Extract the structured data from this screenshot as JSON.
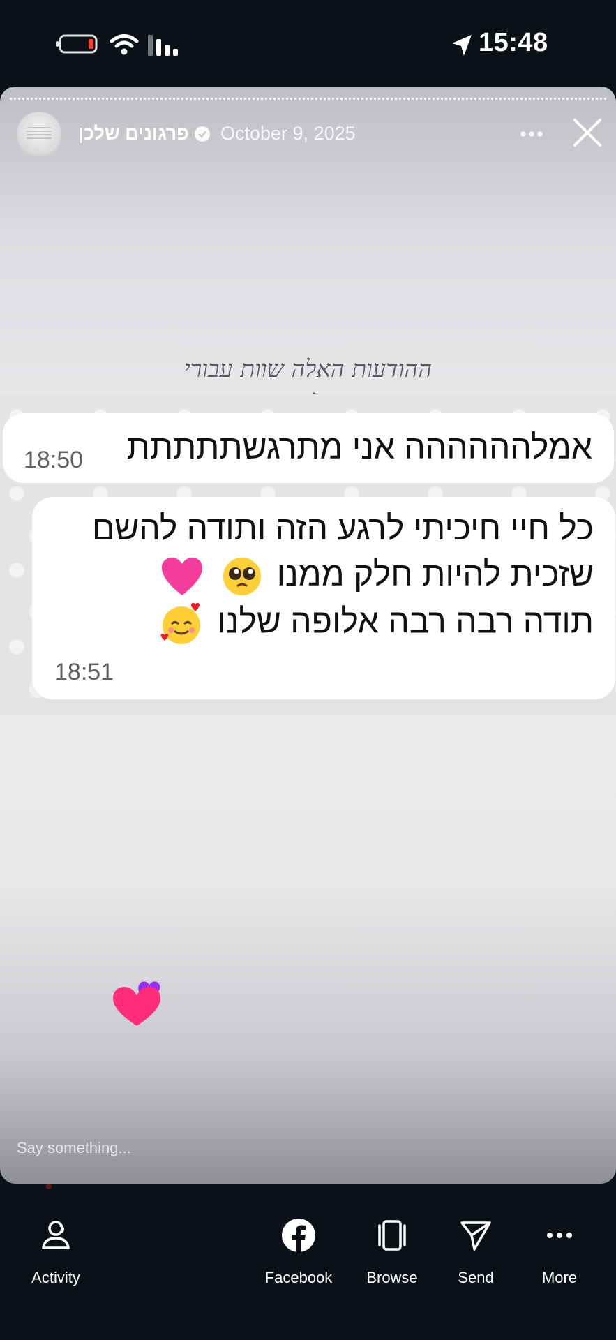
{
  "status_bar": {
    "time": "15:48",
    "icons": [
      "battery-low-icon",
      "wifi-icon",
      "signal-icon",
      "location-arrow-icon"
    ]
  },
  "story": {
    "account_name": "פרגונים שלכן",
    "date": "October 9, 2025",
    "caption_line1": "ההודעות האלה שוות עבורי",
    "caption_line2": "אוויר לנשימה!",
    "reply_placeholder": "Say something..."
  },
  "chat": {
    "message1": {
      "text": "אמלהההההה אני מתרגשתתתתת",
      "time": "18:50"
    },
    "message2": {
      "line1": "כל חיי חיכיתי לרגע הזה ותודה להשם",
      "line2": "שזכית להיות חלק ממנו",
      "line3": "תודה רבה רבה אלופה שלנו",
      "time": "18:51"
    }
  },
  "nav": {
    "activity": "Activity",
    "facebook": "Facebook",
    "browse": "Browse",
    "send": "Send",
    "more": "More"
  },
  "colors": {
    "background": "#0c1118",
    "bubble": "#ffffff",
    "heart_pink": "#ff2d7a",
    "heart_purple": "#9b2ff0"
  }
}
